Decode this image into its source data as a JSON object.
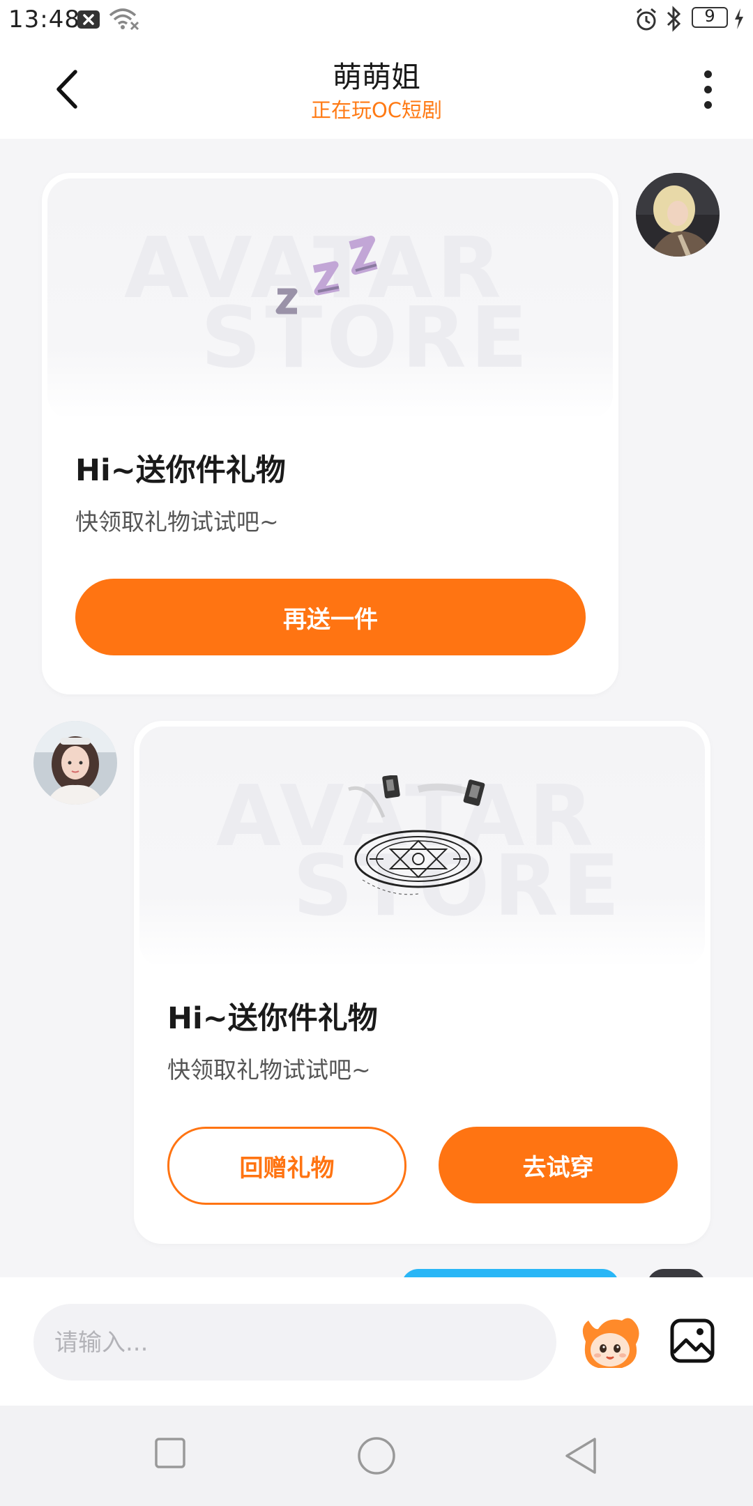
{
  "status": {
    "time": "13:48",
    "battery": "9"
  },
  "header": {
    "title": "萌萌姐",
    "subtitle": "正在玩OC短剧"
  },
  "messages": [
    {
      "side": "right",
      "title": "Hi~送你件礼物",
      "subtitle": "快领取礼物试试吧~",
      "button": "再送一件",
      "watermark_line1": "AVATAR",
      "watermark_line2": "STORE"
    },
    {
      "side": "left",
      "title": "Hi~送你件礼物",
      "subtitle": "快领取礼物试试吧~",
      "button_return": "回赠礼物",
      "button_try": "去试穿",
      "watermark_line1": "AVATAR",
      "watermark_line2": "STORE"
    }
  ],
  "input": {
    "placeholder": "请输入..."
  },
  "colors": {
    "accent": "#ff7412",
    "subtitle": "#ff7a14",
    "background": "#f5f5f7",
    "next_bubble": "#29b6f6"
  },
  "icons": {
    "back": "chevron-left-icon",
    "more": "vertical-dots-icon",
    "mascot": "mascot-icon",
    "image": "image-icon"
  }
}
